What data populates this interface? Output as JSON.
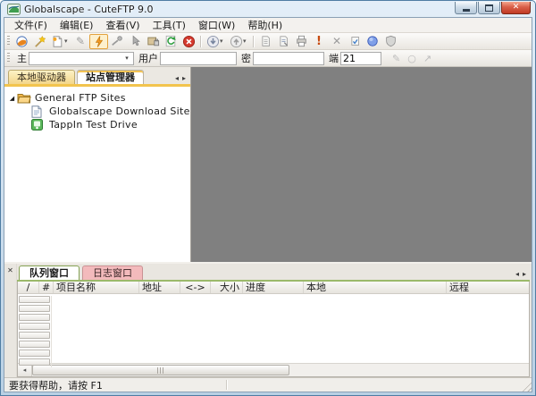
{
  "window": {
    "title": "Globalscape - CuteFTP 9.0"
  },
  "glyphs": {
    "close": "✕",
    "panel_close": "✕",
    "scroll_left": "◂",
    "scroll_right": "▸",
    "expander_expanded": "◢",
    "dropdown": "▾",
    "alert_exclamation": "!",
    "delete_x": "✕",
    "edit_pencil": "✎",
    "cursor_arrow": "↖",
    "ring": "○",
    "pointer": "↗"
  },
  "menu": {
    "items": [
      {
        "label": "文件(F)"
      },
      {
        "label": "编辑(E)"
      },
      {
        "label": "查看(V)"
      },
      {
        "label": "工具(T)"
      },
      {
        "label": "窗口(W)"
      },
      {
        "label": "帮助(H)"
      }
    ]
  },
  "toolbar": {
    "icons": [
      "site-manager",
      "connection-wizard",
      "new-document",
      "edit-disconnected",
      "connect",
      "reconnect",
      "pointer",
      "session-lock",
      "refresh",
      "stop",
      "download",
      "upload",
      "schedule-document",
      "log-document",
      "print",
      "alert",
      "delete",
      "verify-document",
      "web-globe",
      "security-shield"
    ]
  },
  "connect_bar": {
    "host_label": "主",
    "host_value": "",
    "user_label": "用户",
    "user_value": "",
    "password_label": "密",
    "password_value": "",
    "port_label": "端",
    "port_value": "21"
  },
  "site_panel": {
    "tabs": [
      {
        "label": "本地驱动器",
        "active": false
      },
      {
        "label": "站点管理器",
        "active": true
      }
    ],
    "tree": [
      {
        "label": "General FTP Sites",
        "icon": "folder-open-icon",
        "level": 0,
        "expanded": true
      },
      {
        "label": "Globalscape Download Site",
        "icon": "site-document-icon",
        "level": 1
      },
      {
        "label": "TappIn Test Drive",
        "icon": "tappin-icon",
        "level": 1
      }
    ]
  },
  "bottom_panel": {
    "tabs": [
      {
        "label": "队列窗口",
        "active": true
      },
      {
        "label": "日志窗口",
        "active": false
      }
    ],
    "queue_table": {
      "columns": [
        "/",
        "#",
        "项目名称",
        "地址",
        "<->",
        "大小",
        "进度",
        "本地",
        "远程"
      ],
      "rows": [],
      "empty_row_slots": 8
    }
  },
  "status_bar": {
    "text": "要获得帮助，请按 F1"
  },
  "colors": {
    "titlebar_blue": "#cfe0f0",
    "mdi_background": "#808080",
    "tab_accent_yellow": "#f2c44e",
    "queue_tab_green": "#9cb96b",
    "log_tab_pink": "#f3babc",
    "connect_orange": "#f59a23",
    "stop_red": "#d43a2f"
  }
}
